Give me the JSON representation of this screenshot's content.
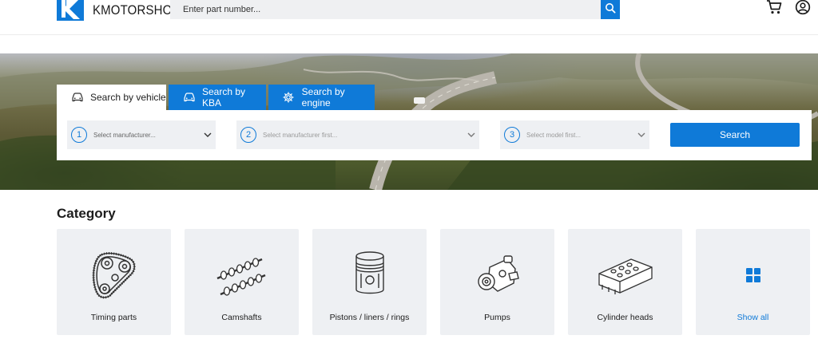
{
  "brand": {
    "name": "KMOTORSHOP"
  },
  "search": {
    "placeholder": "Enter part number..."
  },
  "header_icons": [
    "search-icon",
    "cart-icon",
    "account-icon"
  ],
  "vehicle_search": {
    "tabs": [
      {
        "label": "Search by vehicle",
        "icon": "car-icon",
        "active": true
      },
      {
        "label": "Search by KBA",
        "icon": "car-icon",
        "active": false
      },
      {
        "label": "Search by engine",
        "icon": "engine-gear-icon",
        "active": false
      }
    ],
    "selects": [
      {
        "step": "1",
        "placeholder": "Select manufacturer..."
      },
      {
        "step": "2",
        "placeholder": "Select manufacturer first..."
      },
      {
        "step": "3",
        "placeholder": "Select model first..."
      }
    ],
    "search_label": "Search"
  },
  "category": {
    "title": "Category",
    "items": [
      {
        "label": "Timing parts",
        "icon": "timing-belt-icon"
      },
      {
        "label": "Camshafts",
        "icon": "camshaft-icon"
      },
      {
        "label": "Pistons / liners / rings",
        "icon": "piston-icon"
      },
      {
        "label": "Pumps",
        "icon": "pump-icon"
      },
      {
        "label": "Cylinder heads",
        "icon": "cylinder-head-icon"
      },
      {
        "label": "Show all",
        "icon": "grid-icon"
      }
    ]
  },
  "colors": {
    "accent": "#0f7ad8",
    "card_bg": "#eef0f3",
    "text": "#1c1c1c"
  }
}
